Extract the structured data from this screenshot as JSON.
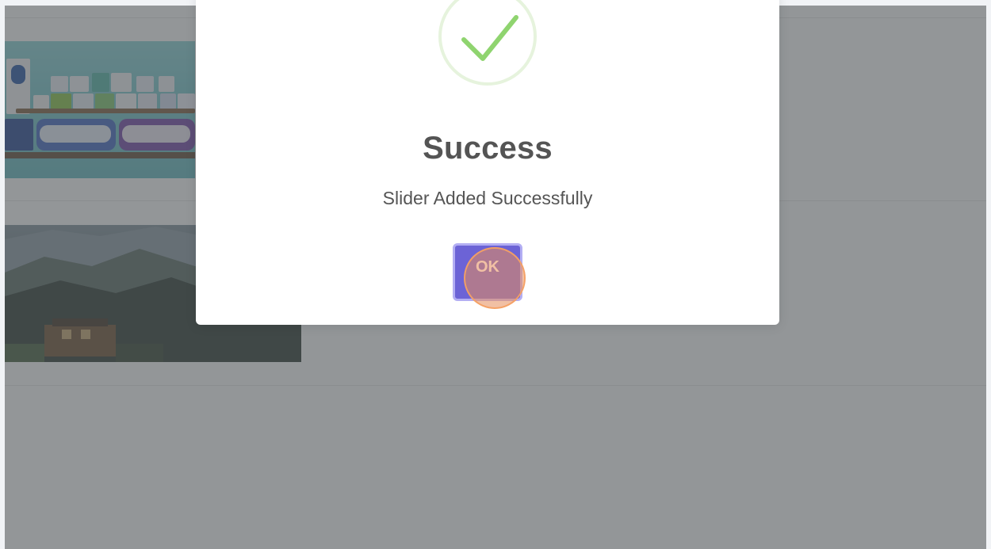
{
  "dialog": {
    "title": "Success",
    "message": "Slider Added Successfully",
    "ok_label": "OK",
    "icon": "check-circle-icon",
    "accent_color": "#6c63d6",
    "success_color": "#8fd46f"
  },
  "background": {
    "slider_images": [
      "tissue-products-image",
      "mountain-monastery-image"
    ]
  }
}
